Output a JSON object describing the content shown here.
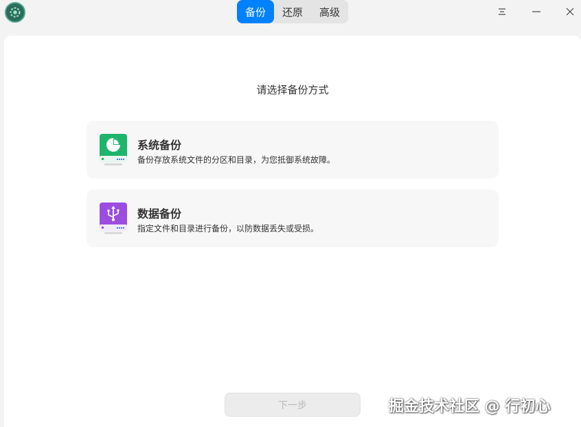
{
  "titlebar": {
    "tabs": [
      {
        "label": "备份",
        "active": true
      },
      {
        "label": "还原",
        "active": false
      },
      {
        "label": "高级",
        "active": false
      }
    ],
    "menu_icon": "menu-icon",
    "minimize_icon": "minimize-icon",
    "close_icon": "close-icon"
  },
  "main": {
    "heading": "请选择备份方式",
    "options": [
      {
        "title": "系统备份",
        "desc": "备份存放系统文件的分区和目录，为您抵御系统故障。",
        "icon": "system-backup-icon",
        "color": "#1db56a"
      },
      {
        "title": "数据备份",
        "desc": "指定文件和目录进行备份，以防数据丢失或受损。",
        "icon": "data-backup-icon",
        "color": "#9b4de0"
      }
    ],
    "next_label": "下一步"
  },
  "watermark": "掘金技术社区 @ 行初心",
  "colors": {
    "accent": "#0081ff",
    "background": "#f3f3f3",
    "card": "#f7f7f7"
  }
}
